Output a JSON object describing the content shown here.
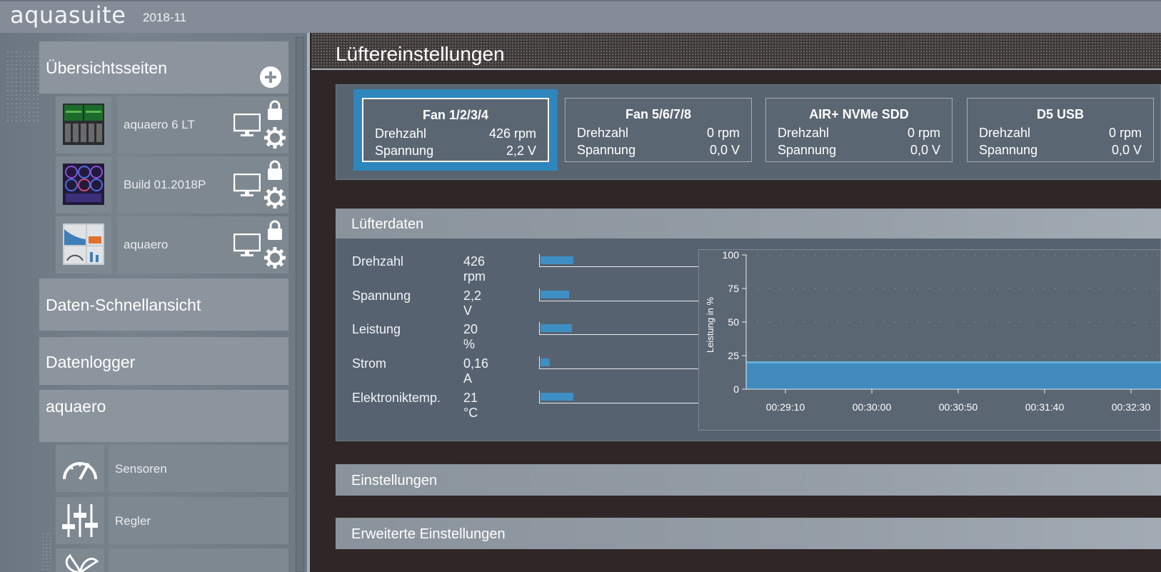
{
  "app": {
    "name": "aquasuite",
    "version": "2018-11"
  },
  "sidebar": {
    "overview_title": "Übersichtsseiten",
    "overview_items": [
      {
        "label": "aquaero 6 LT"
      },
      {
        "label": "Build 01.2018P"
      },
      {
        "label": "aquaero"
      }
    ],
    "quick_view": "Daten-Schnellansicht",
    "data_logger": "Datenlogger",
    "device_section": "aquaero",
    "device_items": [
      {
        "label": "Sensoren",
        "icon": "gauge-icon"
      },
      {
        "label": "Regler",
        "icon": "sliders-icon"
      },
      {
        "label": "",
        "icon": "fan-icon"
      }
    ]
  },
  "page": {
    "title": "Lüftereinstellungen"
  },
  "devices": [
    {
      "name": "Fan 1/2/3/4",
      "speed_label": "Drehzahl",
      "speed": "426 rpm",
      "voltage_label": "Spannung",
      "voltage": "2,2 V",
      "selected": true
    },
    {
      "name": "Fan 5/6/7/8",
      "speed_label": "Drehzahl",
      "speed": "0 rpm",
      "voltage_label": "Spannung",
      "voltage": "0,0 V",
      "selected": false
    },
    {
      "name": "AIR+ NVMe SDD",
      "speed_label": "Drehzahl",
      "speed": "0 rpm",
      "voltage_label": "Spannung",
      "voltage": "0,0 V",
      "selected": false
    },
    {
      "name": "D5 USB",
      "speed_label": "Drehzahl",
      "speed": "0 rpm",
      "voltage_label": "Spannung",
      "voltage": "0,0 V",
      "selected": false
    }
  ],
  "fan_data": {
    "title": "Lüfterdaten",
    "rows": [
      {
        "label": "Drehzahl",
        "value": "426 rpm",
        "level": 0.21
      },
      {
        "label": "Spannung",
        "value": "2,2 V",
        "level": 0.18
      },
      {
        "label": "Leistung",
        "value": "20 %",
        "level": 0.2
      },
      {
        "label": "Strom",
        "value": "0,16 A",
        "level": 0.06
      },
      {
        "label": "Elektroniktemp.",
        "value": "21 °C",
        "level": 0.21
      }
    ]
  },
  "chart_data": {
    "type": "area",
    "ylabel": "Leistung in %",
    "ylim": [
      0,
      100
    ],
    "yticks": [
      0,
      25,
      50,
      75,
      100
    ],
    "xticks": [
      "00:29:10",
      "00:30:00",
      "00:30:50",
      "00:31:40",
      "00:32:30"
    ],
    "values": [
      20,
      20,
      20,
      20,
      20,
      20
    ],
    "grid": true,
    "color": "#3d8fc4"
  },
  "sections": {
    "settings": "Einstellungen",
    "advanced": "Erweiterte Einstellungen"
  },
  "colors": {
    "accent": "#2f86bd",
    "fill": "#3d8fc4",
    "line": "#6ab8e6"
  }
}
